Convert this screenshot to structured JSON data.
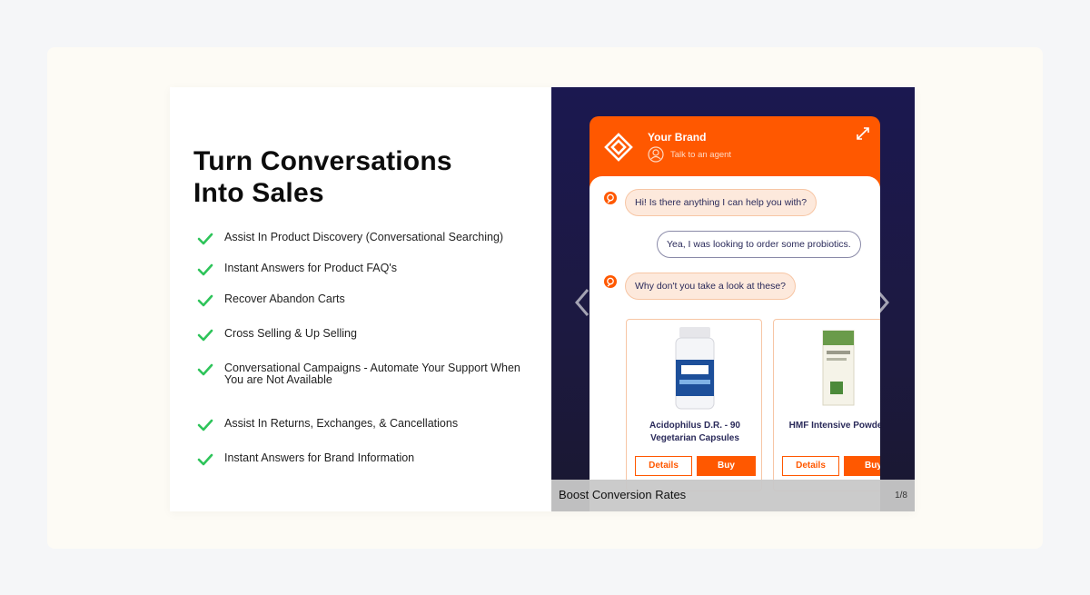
{
  "headline": {
    "line1": "Turn Conversations",
    "line2": "Into Sales"
  },
  "features": [
    {
      "text": "Assist In Product Discovery (Conversational Searching)"
    },
    {
      "text": "Instant Answers for Product FAQ's"
    },
    {
      "text": "Recover Abandon Carts"
    },
    {
      "text": "Cross Selling & Up Selling"
    },
    {
      "text": "Conversational Campaigns - Automate Your Support When You are Not Available"
    },
    {
      "text": "Assist In Returns, Exchanges, & Cancellations"
    },
    {
      "text": "Instant Answers for Brand Information"
    }
  ],
  "widget": {
    "brand": "Your Brand",
    "agent_link": "Talk to an agent",
    "messages": [
      {
        "from": "bot",
        "text": "Hi! Is there anything I can help you with?"
      },
      {
        "from": "user",
        "text": "Yea, I was looking to order some probiotics."
      },
      {
        "from": "bot",
        "text": "Why don't you take a look at these?"
      }
    ],
    "products": [
      {
        "name": "Acidophilus D.R. - 90 Vegetarian Capsules",
        "details_label": "Details",
        "buy_label": "Buy"
      },
      {
        "name": "HMF Intensive Powde oz",
        "details_label": "Details",
        "buy_label": "Buy"
      }
    ]
  },
  "carousel": {
    "caption": "Boost Conversion Rates",
    "counter": "1/8",
    "prev_icon": "chevron-left-icon",
    "next_icon": "chevron-right-icon"
  },
  "colors": {
    "accent": "#ff5800",
    "check": "#2ec45a",
    "panel_bg": "#1b1850"
  }
}
